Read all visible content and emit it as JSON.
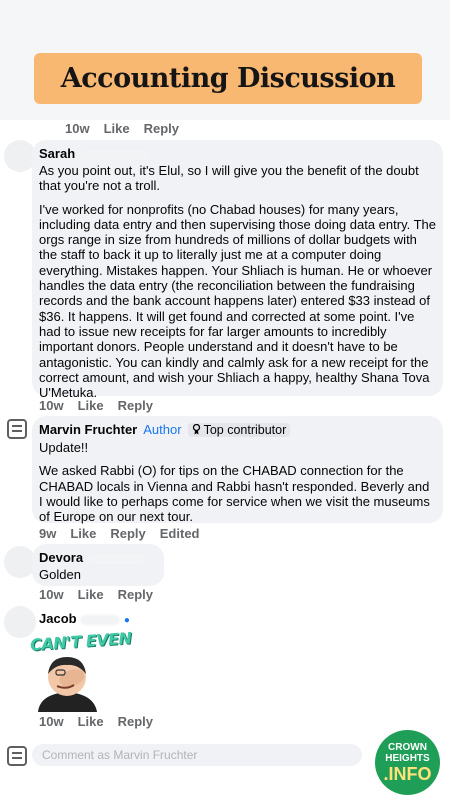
{
  "banner": {
    "title": "Accounting Discussion"
  },
  "meta_top": {
    "time": "10w",
    "like": "Like",
    "reply": "Reply"
  },
  "comment_sarah": {
    "name": "Sarah",
    "paragraphs": [
      "As you point out, it's Elul, so I will give you the benefit of the doubt that you're not a troll.",
      "I've worked for nonprofits (no Chabad houses) for many years, including data entry and then supervising those doing data entry. The orgs range in size from hundreds of millions of dollar budgets with the staff to back it up to literally just me at a computer doing everything. Mistakes happen. Your Shliach is human. He or whoever handles the data entry (the reconciliation between the fundraising records and the bank account happens later) entered $33 instead of $36. It happens. It will get found and corrected at some point. I've had to issue new receipts for far larger amounts to incredibly important donors. People understand and it doesn't have to be antagonistic. You can kindly and calmly ask for a new receipt for the correct amount, and wish your Shliach a happy, healthy Shana Tova U'Metuka."
    ],
    "meta": {
      "time": "10w",
      "like": "Like",
      "reply": "Reply"
    }
  },
  "comment_marvin": {
    "name": "Marvin Fruchter",
    "author_label": "Author",
    "badge": "Top contributor",
    "badge_icon": "medal-icon",
    "paragraphs": [
      "Update!!",
      "We asked Rabbi (O) for tips on the CHABAD connection for the CHABAD locals in Vienna and Rabbi hasn't responded. Beverly and I would like to perhaps come for service when we visit the museums of Europe on our next tour."
    ],
    "meta": {
      "time": "9w",
      "like": "Like",
      "reply": "Reply",
      "edited": "Edited"
    }
  },
  "comment_devora": {
    "name": "Devora",
    "text": "Golden",
    "meta": {
      "time": "10w",
      "like": "Like",
      "reply": "Reply"
    }
  },
  "comment_jacob": {
    "name": "Jacob",
    "sticker_text": "CAN'T EVEN",
    "meta": {
      "time": "10w",
      "like": "Like",
      "reply": "Reply"
    }
  },
  "composer": {
    "placeholder": "Comment as Marvin Fruchter"
  },
  "logo": {
    "line1": "CROWN",
    "line2": "HEIGHTS",
    "line3": ".INFO"
  },
  "colors": {
    "banner": "#f9b871",
    "bubble": "#f0f2f5",
    "link": "#1877f2",
    "logo": "#1f9e57"
  }
}
